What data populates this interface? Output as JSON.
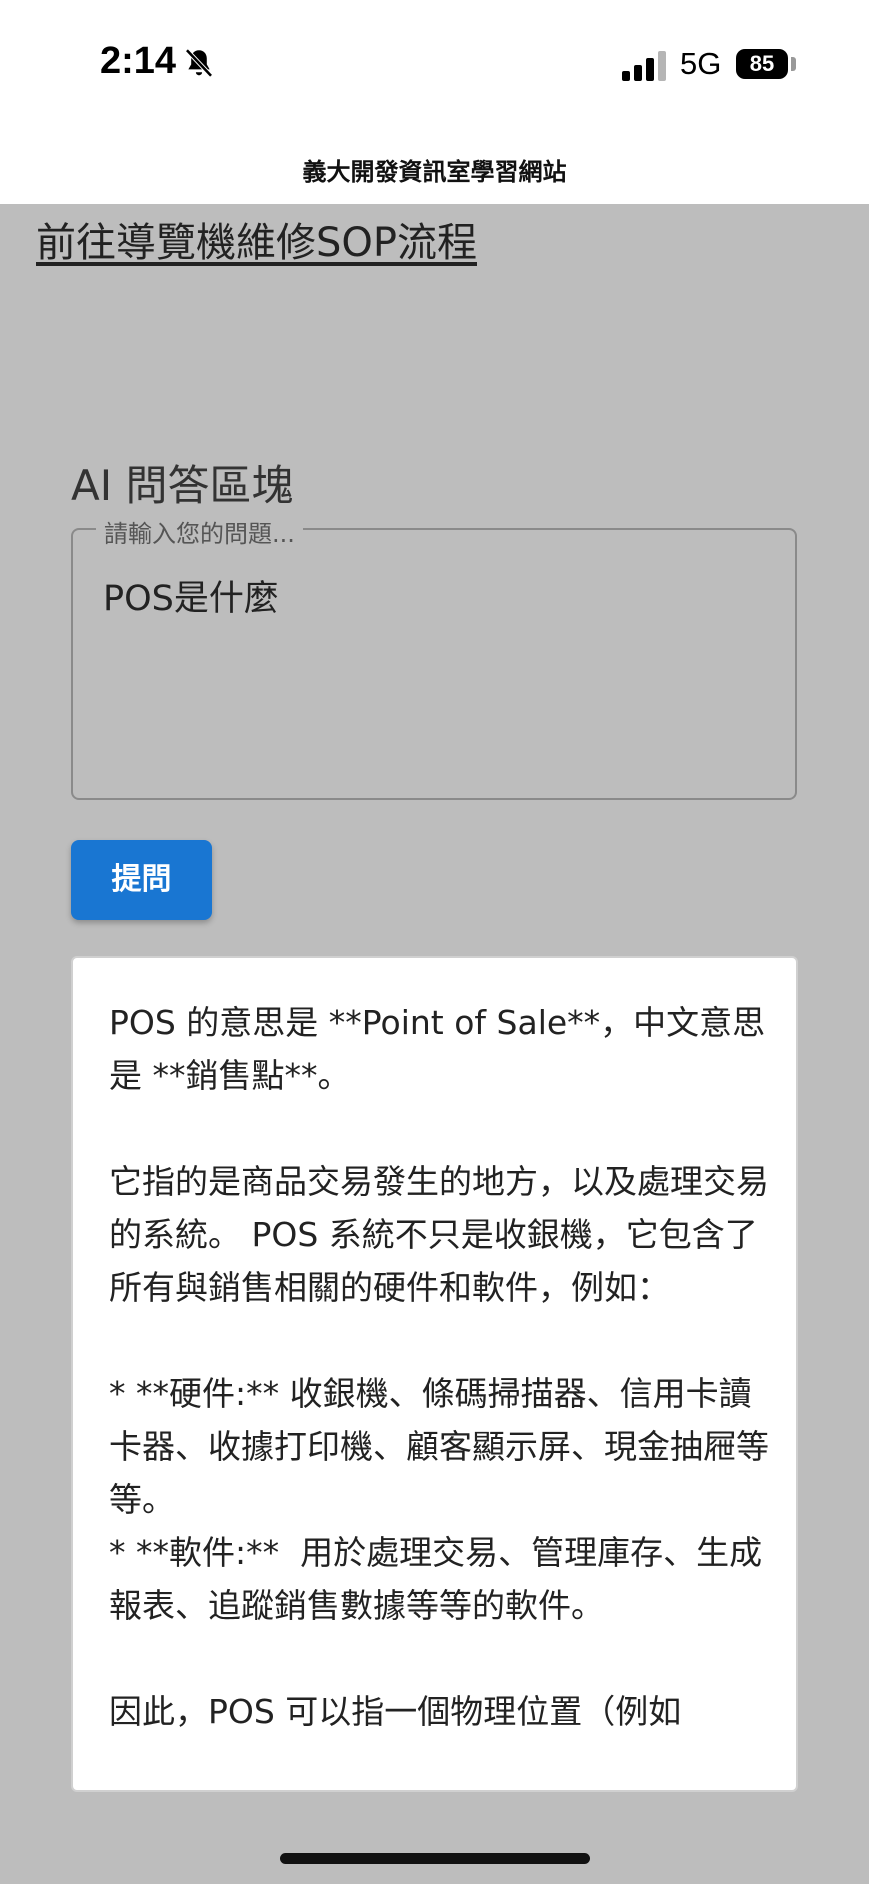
{
  "status_bar": {
    "time": "2:14",
    "silent_icon": "bell-slash-icon",
    "signal_icon": "cellular-signal-icon",
    "network": "5G",
    "battery_level": "85"
  },
  "header": {
    "site_title": "義大開發資訊室學習網站"
  },
  "links": {
    "sop_link": "前往導覽機維修SOP流程"
  },
  "qa": {
    "heading": "AI 問答區塊",
    "input_label": "請輸入您的問題...",
    "input_value": "POS是什麼",
    "submit_label": "提問"
  },
  "answer": {
    "text": "POS 的意思是 **Point of Sale**，中文意思是 **銷售點**。\n\n它指的是商品交易發生的地方，以及處理交易的系統。 POS 系統不只是收銀機，它包含了所有與銷售相關的硬件和軟件，例如：\n\n* **硬件:** 收銀機、條碼掃描器、信用卡讀卡器、收據打印機、顧客顯示屏、現金抽屜等等。\n* **軟件:**  用於處理交易、管理庫存、生成報表、追蹤銷售數據等等的軟件。\n\n因此，POS 可以指一個物理位置（例如"
  }
}
